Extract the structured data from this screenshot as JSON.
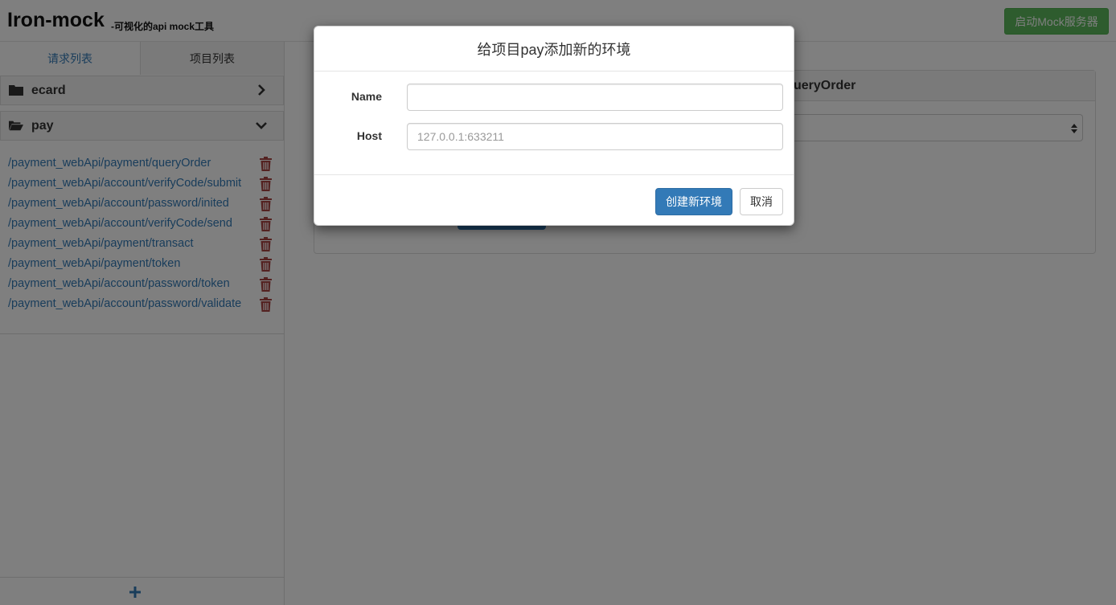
{
  "header": {
    "brand": "Iron-mock",
    "subtitle": "-可视化的api mock工具",
    "start_button": "启动Mock服务器"
  },
  "sidebar": {
    "tabs": [
      {
        "label": "请求列表",
        "active": true
      },
      {
        "label": "项目列表",
        "active": false
      }
    ],
    "groups": [
      {
        "label": "ecard",
        "expanded": false
      },
      {
        "label": "pay",
        "expanded": true
      }
    ],
    "requests": [
      "/payment_webApi/payment/queryOrder",
      "/payment_webApi/account/verifyCode/submit",
      "/payment_webApi/account/password/inited",
      "/payment_webApi/account/verifyCode/send",
      "/payment_webApi/payment/transact",
      "/payment_webApi/payment/token",
      "/payment_webApi/account/password/token",
      "/payment_webApi/account/password/validate"
    ]
  },
  "main": {
    "panel_title_visible": "ueryOrder"
  },
  "modal": {
    "title": "给项目pay添加新的环境",
    "fields": {
      "name_label": "Name",
      "name_value": "",
      "host_label": "Host",
      "host_placeholder": "127.0.0.1:633211"
    },
    "confirm_button": "创建新环境",
    "cancel_button": "取消"
  },
  "colors": {
    "link": "#337ab7",
    "primary": "#337ab7",
    "success": "#5cb85c",
    "danger": "#a94442"
  }
}
